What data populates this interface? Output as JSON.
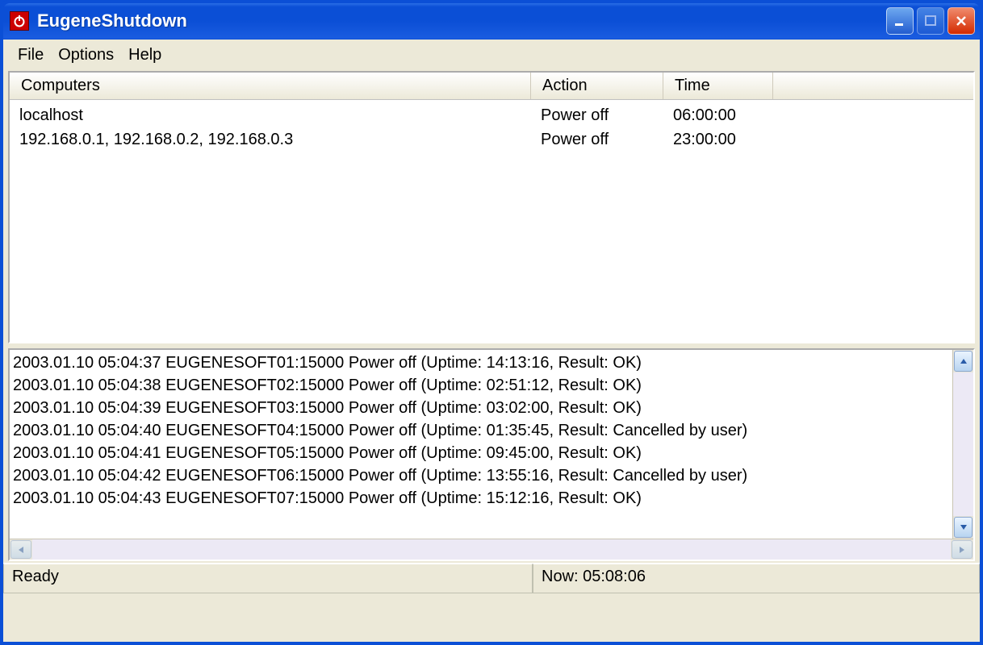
{
  "window": {
    "title": "EugeneShutdown",
    "app_icon_name": "power-icon"
  },
  "menu": {
    "file": "File",
    "options": "Options",
    "help": "Help"
  },
  "list": {
    "headers": {
      "computers": "Computers",
      "action": "Action",
      "time": "Time"
    },
    "rows": [
      {
        "computers": "localhost",
        "action": "Power off",
        "time": "06:00:00"
      },
      {
        "computers": "192.168.0.1, 192.168.0.2, 192.168.0.3",
        "action": "Power off",
        "time": "23:00:00"
      }
    ]
  },
  "log": {
    "lines": [
      "2003.01.10 05:04:37 EUGENESOFT01:15000 Power off (Uptime: 14:13:16, Result: OK)",
      "2003.01.10 05:04:38 EUGENESOFT02:15000 Power off (Uptime: 02:51:12, Result: OK)",
      "2003.01.10 05:04:39 EUGENESOFT03:15000 Power off (Uptime: 03:02:00, Result: OK)",
      "2003.01.10 05:04:40 EUGENESOFT04:15000 Power off (Uptime: 01:35:45, Result: Cancelled by user)",
      "2003.01.10 05:04:41 EUGENESOFT05:15000 Power off (Uptime: 09:45:00, Result: OK)",
      "2003.01.10 05:04:42 EUGENESOFT06:15000 Power off (Uptime: 13:55:16, Result: Cancelled by user)",
      "2003.01.10 05:04:43 EUGENESOFT07:15000 Power off (Uptime: 15:12:16, Result: OK)"
    ]
  },
  "status": {
    "ready": "Ready",
    "now": "Now: 05:08:06"
  }
}
